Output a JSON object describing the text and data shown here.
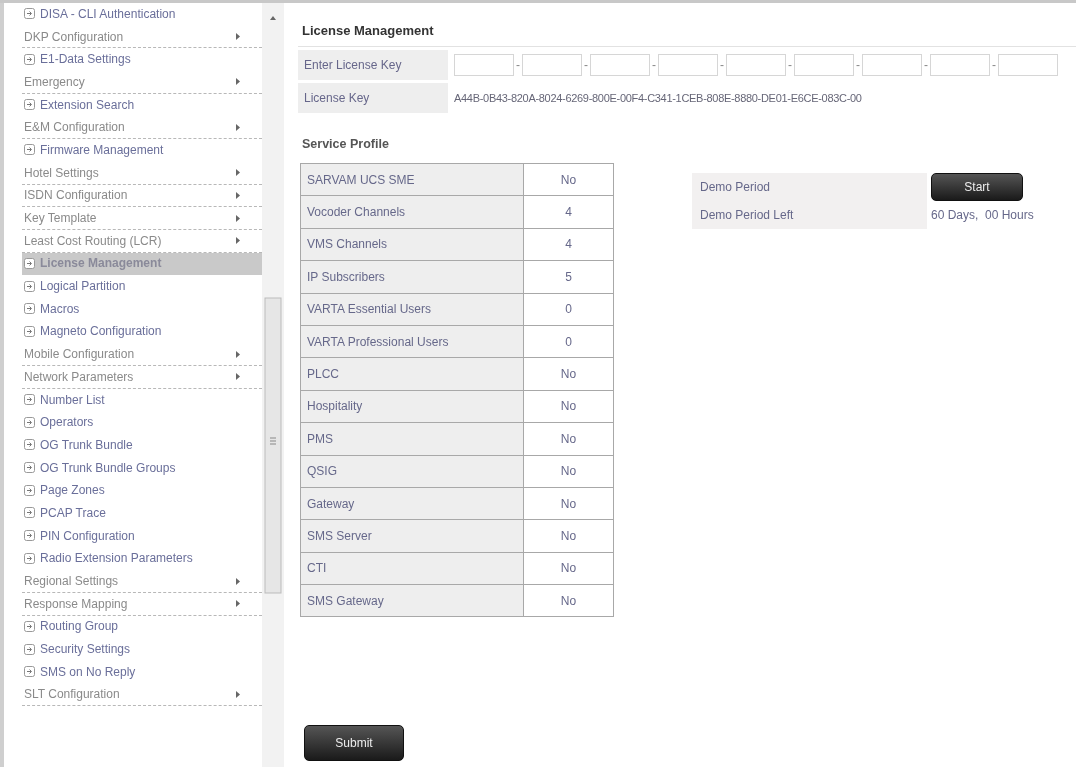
{
  "sidebar": {
    "items": [
      {
        "kind": "link",
        "label": "DISA - CLI Authentication",
        "selected": false
      },
      {
        "kind": "menu",
        "label": "DKP Configuration",
        "selected": false
      },
      {
        "kind": "link",
        "label": "E1-Data Settings",
        "selected": false
      },
      {
        "kind": "menu",
        "label": "Emergency",
        "selected": false
      },
      {
        "kind": "link",
        "label": "Extension Search",
        "selected": false
      },
      {
        "kind": "menu",
        "label": "E&M Configuration",
        "selected": false
      },
      {
        "kind": "link",
        "label": "Firmware Management",
        "selected": false
      },
      {
        "kind": "menu",
        "label": "Hotel Settings",
        "selected": false
      },
      {
        "kind": "menu",
        "label": "ISDN Configuration",
        "selected": false
      },
      {
        "kind": "menu",
        "label": "Key Template",
        "selected": false
      },
      {
        "kind": "menu",
        "label": "Least Cost Routing (LCR)",
        "selected": false
      },
      {
        "kind": "link",
        "label": "License Management",
        "selected": true
      },
      {
        "kind": "link",
        "label": "Logical Partition",
        "selected": false
      },
      {
        "kind": "link",
        "label": "Macros",
        "selected": false
      },
      {
        "kind": "link",
        "label": "Magneto Configuration",
        "selected": false
      },
      {
        "kind": "menu",
        "label": "Mobile Configuration",
        "selected": false
      },
      {
        "kind": "menu",
        "label": "Network Parameters",
        "selected": false
      },
      {
        "kind": "link",
        "label": "Number List",
        "selected": false
      },
      {
        "kind": "link",
        "label": "Operators",
        "selected": false
      },
      {
        "kind": "link",
        "label": "OG Trunk Bundle",
        "selected": false
      },
      {
        "kind": "link",
        "label": "OG Trunk Bundle Groups",
        "selected": false
      },
      {
        "kind": "link",
        "label": "Page Zones",
        "selected": false
      },
      {
        "kind": "link",
        "label": "PCAP Trace",
        "selected": false
      },
      {
        "kind": "link",
        "label": "PIN Configuration",
        "selected": false
      },
      {
        "kind": "link",
        "label": "Radio Extension Parameters",
        "selected": false
      },
      {
        "kind": "menu",
        "label": "Regional Settings",
        "selected": false
      },
      {
        "kind": "menu",
        "label": "Response Mapping",
        "selected": false
      },
      {
        "kind": "link",
        "label": "Routing Group",
        "selected": false
      },
      {
        "kind": "link",
        "label": "Security Settings",
        "selected": false
      },
      {
        "kind": "link",
        "label": "SMS on No Reply",
        "selected": false
      },
      {
        "kind": "menu",
        "label": "SLT Configuration",
        "selected": false
      }
    ]
  },
  "page": {
    "title": "License Management",
    "enter_key": {
      "label": "Enter License Key",
      "separator": "-"
    },
    "license_key": {
      "label": "License Key",
      "value": "A44B-0B43-820A-8024-6269-800E-00F4-C341-1CEB-808E-8880-DE01-E6CE-083C-00"
    },
    "section_title": "Service Profile",
    "service_profile": [
      {
        "name": "SARVAM UCS SME",
        "value": "No"
      },
      {
        "name": "Vocoder Channels",
        "value": "4"
      },
      {
        "name": "VMS Channels",
        "value": "4"
      },
      {
        "name": "IP Subscribers",
        "value": "5"
      },
      {
        "name": "VARTA Essential Users",
        "value": "0"
      },
      {
        "name": "VARTA Professional Users",
        "value": "0"
      },
      {
        "name": "PLCC",
        "value": "No"
      },
      {
        "name": "Hospitality",
        "value": "No"
      },
      {
        "name": "PMS",
        "value": "No"
      },
      {
        "name": "QSIG",
        "value": "No"
      },
      {
        "name": "Gateway",
        "value": "No"
      },
      {
        "name": "SMS Server",
        "value": "No"
      },
      {
        "name": "CTI",
        "value": "No"
      },
      {
        "name": "SMS Gateway",
        "value": "No"
      }
    ],
    "demo": {
      "period_label": "Demo Period",
      "start_button": "Start",
      "left_label": "Demo Period Left",
      "left_value": "60 Days,  00 Hours"
    },
    "submit_button": "Submit"
  }
}
